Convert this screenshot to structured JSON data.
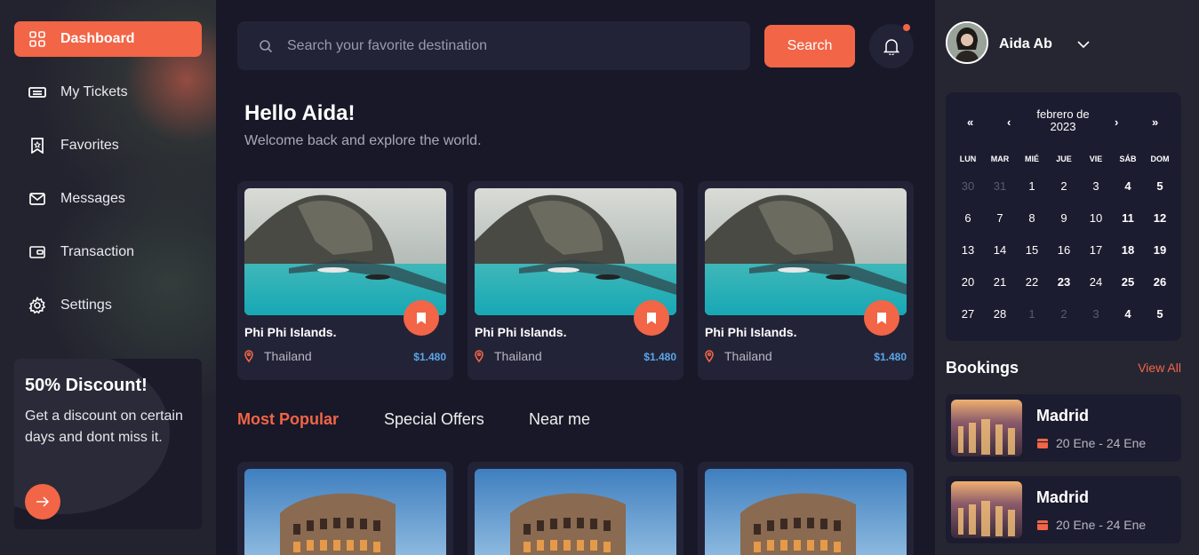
{
  "sidebar": {
    "items": [
      {
        "label": "Dashboard",
        "icon": "grid-icon"
      },
      {
        "label": "My Tickets",
        "icon": "ticket-icon"
      },
      {
        "label": "Favorites",
        "icon": "bookmark-icon"
      },
      {
        "label": "Messages",
        "icon": "envelope-icon"
      },
      {
        "label": "Transaction",
        "icon": "wallet-icon"
      },
      {
        "label": "Settings",
        "icon": "gear-icon"
      }
    ],
    "promo": {
      "title": "50% Discount!",
      "text": "Get a discount on certain days and dont miss it."
    }
  },
  "search": {
    "placeholder": "Search your favorite destination",
    "button_label": "Search"
  },
  "greeting": {
    "title": "Hello Aida!",
    "subtitle": "Welcome back and explore the world."
  },
  "cards": [
    {
      "name": "Phi Phi Islands.",
      "location": "Thailand",
      "price": "$1.480"
    },
    {
      "name": "Phi Phi Islands.",
      "location": "Thailand",
      "price": "$1.480"
    },
    {
      "name": "Phi Phi Islands.",
      "location": "Thailand",
      "price": "$1.480"
    }
  ],
  "tabs": [
    "Most Popular",
    "Special Offers",
    "Near me"
  ],
  "user": {
    "name": "Aida Ab"
  },
  "calendar": {
    "month": "febrero de",
    "year": "2023",
    "nav": {
      "prev_year": "«",
      "prev": "‹",
      "next": "›",
      "next_year": "»"
    },
    "weekdays": [
      "LUN",
      "MAR",
      "MIÉ",
      "JUE",
      "VIE",
      "SÁB",
      "DOM"
    ],
    "weeks": [
      [
        "30",
        "31",
        "1",
        "2",
        "3",
        "4",
        "5"
      ],
      [
        "6",
        "7",
        "8",
        "9",
        "10",
        "11",
        "12"
      ],
      [
        "13",
        "14",
        "15",
        "16",
        "17",
        "18",
        "19"
      ],
      [
        "20",
        "21",
        "22",
        "23",
        "24",
        "25",
        "26"
      ],
      [
        "27",
        "28",
        "1",
        "2",
        "3",
        "4",
        "5"
      ]
    ]
  },
  "bookings": {
    "title": "Bookings",
    "view_all": "View All",
    "items": [
      {
        "city": "Madrid",
        "dates": "20 Ene - 24 Ene"
      },
      {
        "city": "Madrid",
        "dates": "20 Ene - 24 Ene"
      }
    ]
  },
  "colors": {
    "accent": "#f26546",
    "price": "#5aa6e8",
    "bg": "#181828"
  }
}
